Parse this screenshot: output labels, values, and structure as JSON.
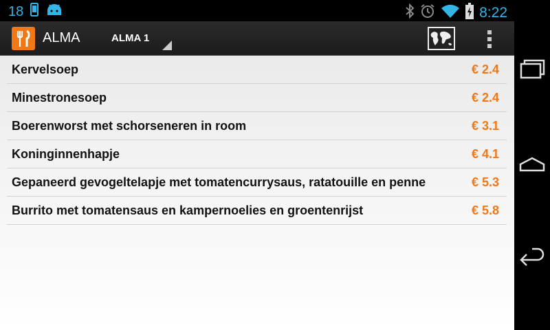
{
  "status_bar": {
    "notification_count": "18",
    "time": "8:22",
    "icons": [
      "phone-icon",
      "android-icon",
      "bluetooth-icon",
      "alarm-icon",
      "wifi-icon",
      "battery-icon"
    ]
  },
  "action_bar": {
    "app_title": "ALMA",
    "spinner_selected": "ALMA 1"
  },
  "menu": {
    "items": [
      {
        "name": "Kervelsoep",
        "price": "€ 2.4"
      },
      {
        "name": "Minestronesoep",
        "price": "€ 2.4"
      },
      {
        "name": "Boerenworst met schorseneren in room",
        "price": "€ 3.1"
      },
      {
        "name": "Koninginnenhapje",
        "price": "€ 4.1"
      },
      {
        "name": "Gepaneerd gevogeltelapje met tomatencurrysaus, ratatouille en penne",
        "price": "€ 5.3"
      },
      {
        "name": "Burrito met tomatensaus en kampernoelies en groentenrijst",
        "price": "€ 5.8"
      }
    ]
  },
  "colors": {
    "accent": "#f07817",
    "status_blue": "#33b5e5",
    "action_bar": "#222222"
  }
}
